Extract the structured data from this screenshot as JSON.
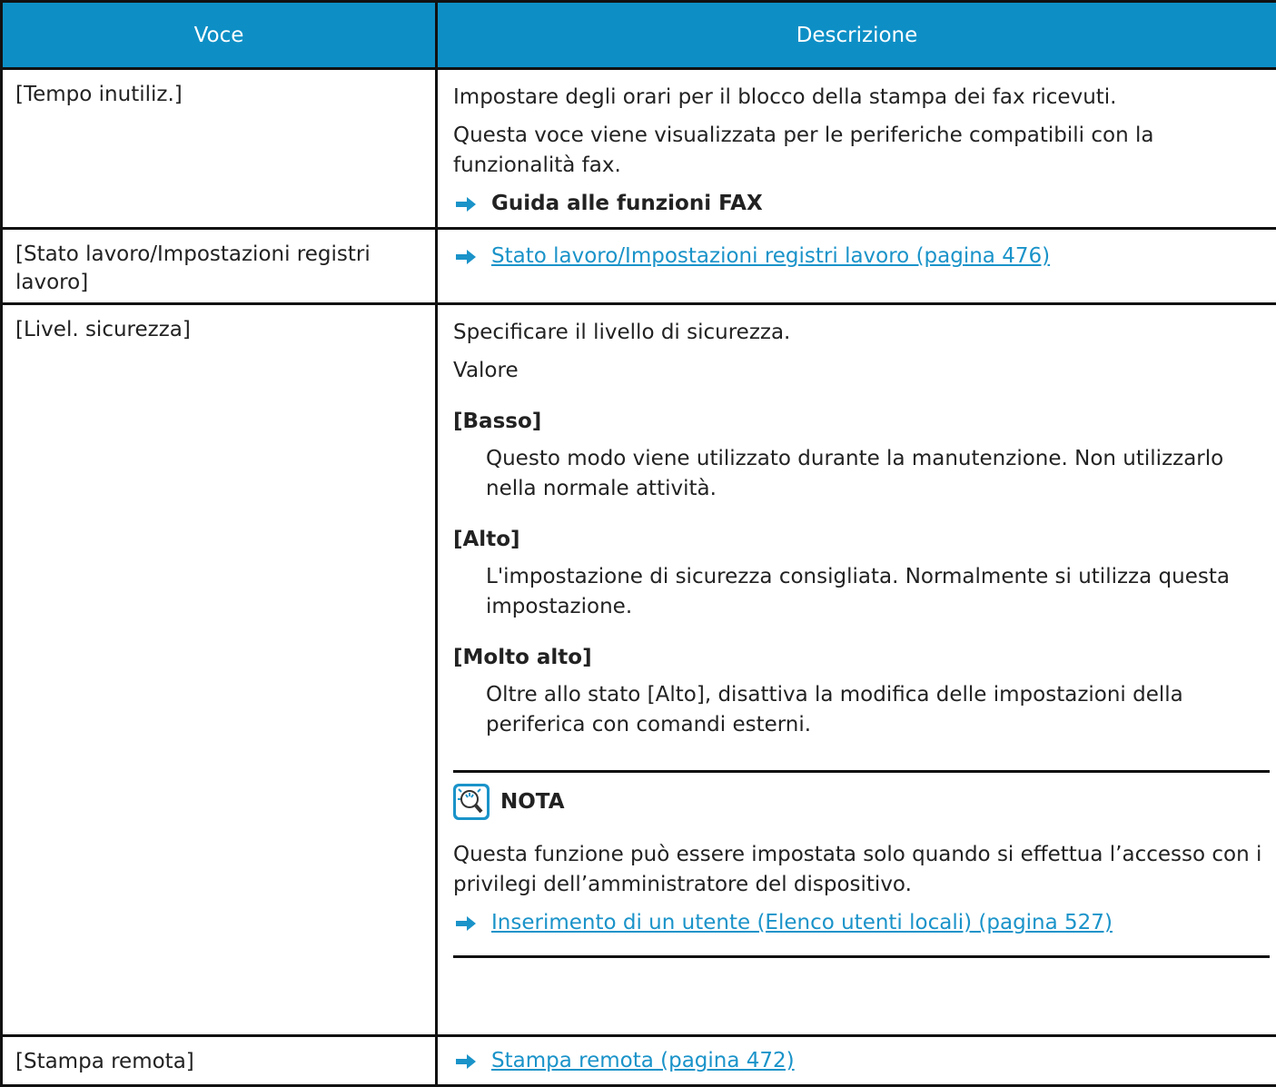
{
  "header": {
    "col1": "Voce",
    "col2": "Descrizione"
  },
  "rows": [
    {
      "item": "[Tempo inutiliz.]",
      "p1": "Impostare degli orari per il blocco della stampa dei fax ricevuti.",
      "p2": "Questa voce viene visualizzata per le periferiche compatibili con la funzionalità fax.",
      "ref": "Guida alle funzioni FAX"
    },
    {
      "item": "[Stato lavoro/Impostazioni registri lavoro]",
      "link": "Stato lavoro/Impostazioni registri lavoro (pagina 476)"
    },
    {
      "item": "[Livel. sicurezza]",
      "p1": "Specificare il livello di sicurezza.",
      "p2": "Valore",
      "options": [
        {
          "label": "[Basso]",
          "desc": "Questo modo viene utilizzato durante la manutenzione. Non utilizzarlo nella normale attività."
        },
        {
          "label": "[Alto]",
          "desc": "L'impostazione di sicurezza consigliata. Normalmente si utilizza questa impostazione."
        },
        {
          "label": "[Molto alto]",
          "desc": "Oltre allo stato [Alto], disattiva la modifica delle impostazioni della periferica con comandi esterni."
        }
      ],
      "note": {
        "title": "NOTA",
        "text": "Questa funzione può essere impostata solo quando si effettua l’accesso con i privilegi dell’amministratore del dispositivo.",
        "link": "Inserimento di un utente (Elenco utenti locali) (pagina 527)"
      }
    },
    {
      "item": "[Stampa remota]",
      "link": "Stampa remota (pagina 472)"
    }
  ],
  "colors": {
    "header_bg": "#0d8fc6",
    "link": "#1a93c9",
    "arrow": "#1a93c9"
  }
}
